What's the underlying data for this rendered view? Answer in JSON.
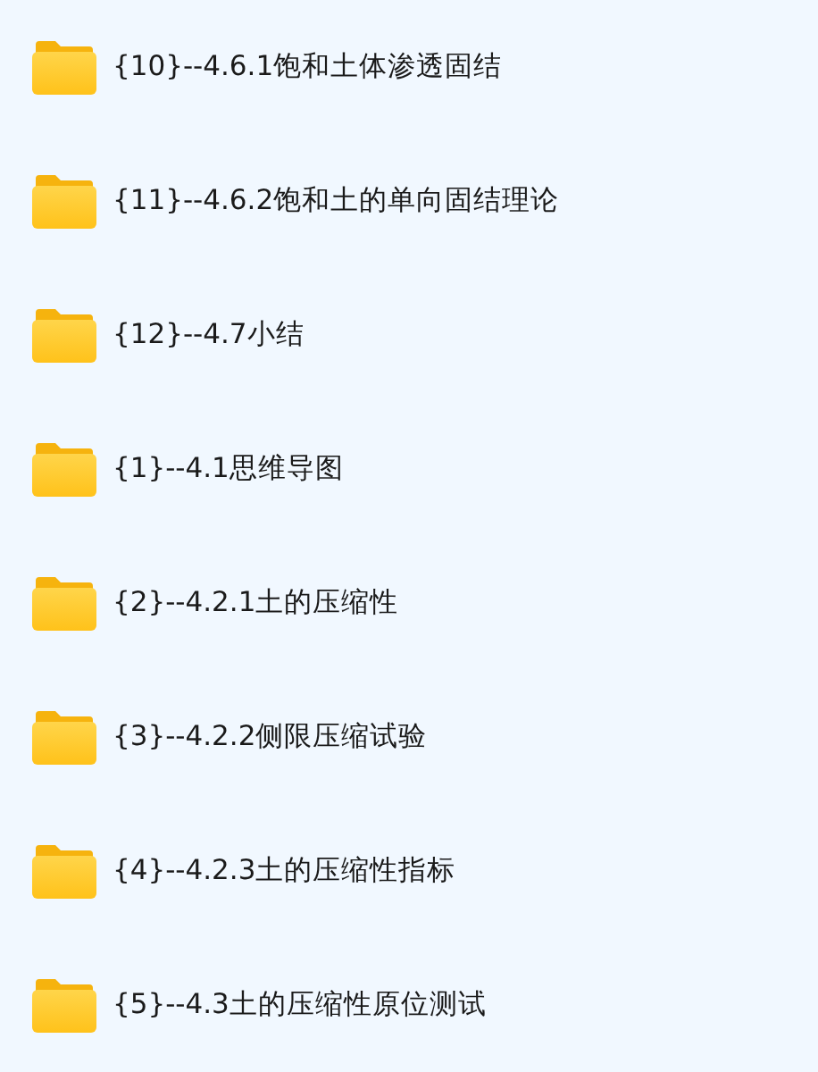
{
  "folders": [
    {
      "name": "{10}--4.6.1饱和土体渗透固结"
    },
    {
      "name": "{11}--4.6.2饱和土的单向固结理论"
    },
    {
      "name": "{12}--4.7小结"
    },
    {
      "name": "{1}--4.1思维导图"
    },
    {
      "name": "{2}--4.2.1土的压缩性"
    },
    {
      "name": "{3}--4.2.2侧限压缩试验"
    },
    {
      "name": "{4}--4.2.3土的压缩性指标"
    },
    {
      "name": "{5}--4.3土的压缩性原位测试"
    }
  ]
}
